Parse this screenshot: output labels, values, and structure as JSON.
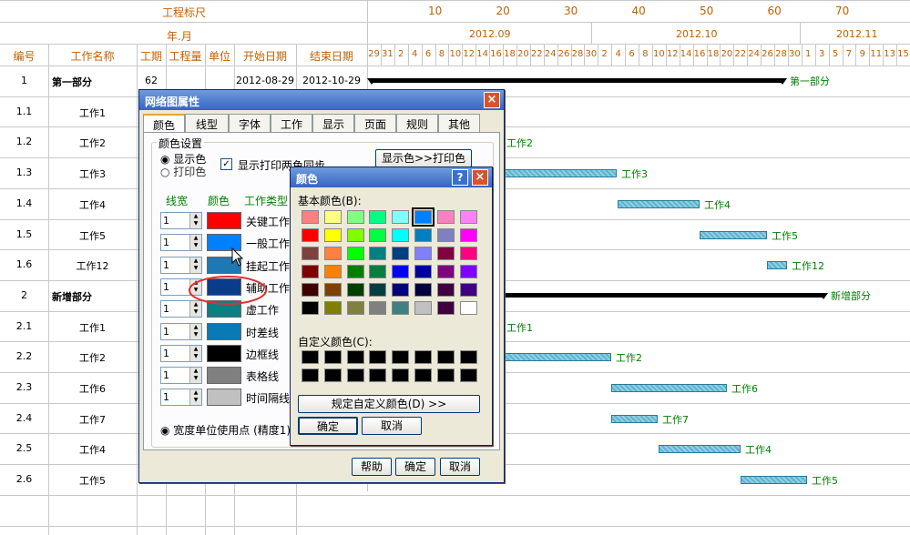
{
  "header": {
    "scale_label": "工程标尺",
    "yearmonth_label": "年.月",
    "scale_ticks": [
      "10",
      "20",
      "30",
      "40",
      "50",
      "60",
      "70"
    ],
    "months": [
      "2012.09",
      "2012.10",
      "2012.11"
    ],
    "columns": [
      "编号",
      "工作名称",
      "工期",
      "工程量",
      "单位",
      "开始日期",
      "结束日期"
    ],
    "days": [
      "29",
      "31",
      "2",
      "4",
      "6",
      "8",
      "10",
      "12",
      "14",
      "16",
      "18",
      "20",
      "22",
      "24",
      "26",
      "28",
      "30",
      "2",
      "4",
      "6",
      "8",
      "10",
      "12",
      "14",
      "16",
      "18",
      "20",
      "22",
      "24",
      "26",
      "28",
      "30",
      "1",
      "3",
      "5",
      "7",
      "9",
      "11",
      "13",
      "15"
    ]
  },
  "rows": [
    {
      "id": "1",
      "name": "第一部分",
      "duration": "62",
      "start": "2012-08-29",
      "end": "2012-10-29",
      "bold": true
    },
    {
      "id": "1.1",
      "name": "工作1"
    },
    {
      "id": "1.2",
      "name": "工作2"
    },
    {
      "id": "1.3",
      "name": "工作3"
    },
    {
      "id": "1.4",
      "name": "工作4"
    },
    {
      "id": "1.5",
      "name": "工作5"
    },
    {
      "id": "1.6",
      "name": "工作12"
    },
    {
      "id": "2",
      "name": "新增部分",
      "bold": true
    },
    {
      "id": "2.1",
      "name": "工作1"
    },
    {
      "id": "2.2",
      "name": "工作2"
    },
    {
      "id": "2.3",
      "name": "工作6"
    },
    {
      "id": "2.4",
      "name": "工作7"
    },
    {
      "id": "2.5",
      "name": "工作4"
    },
    {
      "id": "2.6",
      "name": "工作5"
    }
  ],
  "bar_labels": [
    "第一部分",
    "工作2",
    "工作3",
    "工作4",
    "工作5",
    "工作12",
    "新增部分",
    "工作1",
    "工作2",
    "工作6",
    "工作7",
    "工作4",
    "工作5"
  ],
  "network_dialog": {
    "title": "网络图属性",
    "tabs": [
      "颜色",
      "线型",
      "字体",
      "工作",
      "显示",
      "页面",
      "规则",
      "其他"
    ],
    "group_label": "颜色设置",
    "radio_display": "显示色",
    "radio_print": "打印色",
    "checkbox_label": "显示打印两色同步",
    "display_to_print_button": "显示色>>打印色",
    "col_linewidth": "线宽",
    "col_color": "颜色",
    "col_worktype": "工作类型",
    "rows": [
      {
        "width": "1",
        "type": "关键工作",
        "color": "#ff0000"
      },
      {
        "width": "1",
        "type": "一般工作",
        "color": "#0080ff"
      },
      {
        "width": "1",
        "type": "挂起工作",
        "color": "#1e78b4"
      },
      {
        "width": "1",
        "type": "辅助工作",
        "color": "#0a3c8c"
      },
      {
        "width": "1",
        "type": "虚工作",
        "color": "#0a8080"
      },
      {
        "width": "1",
        "type": "时差线",
        "color": "#0a7ab4"
      },
      {
        "width": "1",
        "type": "边框线",
        "color": "#000000"
      },
      {
        "width": "1",
        "type": "表格线",
        "color": "#808080"
      },
      {
        "width": "1",
        "type": "时间隔线",
        "color": "#c0c0c0"
      }
    ],
    "width_unit_label": "宽度单位使用点 (精度1)",
    "help_button": "帮助",
    "ok_button": "确定",
    "cancel_button": "取消"
  },
  "color_dialog": {
    "title": "颜色",
    "basic_label": "基本颜色(B):",
    "custom_label": "自定义颜色(C):",
    "define_button": "规定自定义颜色(D) >>",
    "ok_button": "确定",
    "cancel_button": "取消",
    "basic_colors": [
      "#ff8080",
      "#ffff80",
      "#80ff80",
      "#00ff80",
      "#80ffff",
      "#0080ff",
      "#ff80c0",
      "#ff80ff",
      "#ff0000",
      "#ffff00",
      "#80ff00",
      "#00ff40",
      "#00ffff",
      "#0080c0",
      "#8080c0",
      "#ff00ff",
      "#804040",
      "#ff8040",
      "#00ff00",
      "#008080",
      "#004080",
      "#8080ff",
      "#800040",
      "#ff0080",
      "#800000",
      "#ff8000",
      "#008000",
      "#008040",
      "#0000ff",
      "#0000a0",
      "#800080",
      "#8000ff",
      "#400000",
      "#804000",
      "#004000",
      "#004040",
      "#000080",
      "#000040",
      "#400040",
      "#400080",
      "#000000",
      "#808000",
      "#808040",
      "#808080",
      "#408080",
      "#c0c0c0",
      "#400040",
      "#ffffff"
    ],
    "selected_index": 5
  }
}
